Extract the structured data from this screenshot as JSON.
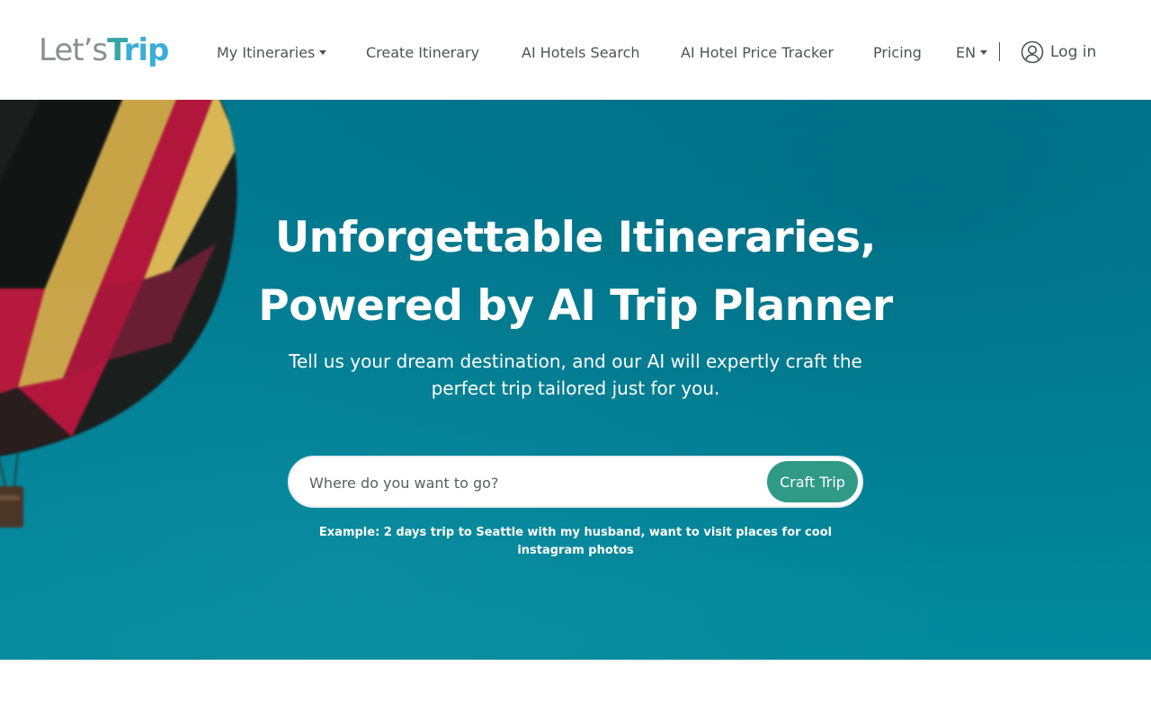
{
  "logo": {
    "part1": "Let’s",
    "part2_t": "T",
    "part2_rest": "rip"
  },
  "nav": {
    "my_itineraries": "My Itineraries",
    "create_itinerary": "Create Itinerary",
    "ai_hotels_search": "AI Hotels Search",
    "ai_hotel_price_tracker": "AI Hotel Price Tracker",
    "pricing": "Pricing",
    "language": "EN",
    "login": "Log in"
  },
  "icons": {
    "user": "user-circle-icon",
    "caret": "caret-down-icon"
  },
  "hero": {
    "title_line1": "Unforgettable Itineraries,",
    "title_line2": "Powered by AI Trip Planner",
    "subtitle": "Tell us your dream destination, and our AI will expertly craft the perfect trip tailored just for you.",
    "search_placeholder": "Where do you want to go?",
    "search_value": "",
    "button_label": "Craft Trip",
    "example": "Example: 2 days trip to Seattle with my husband, want to visit places for cool instagram photos"
  },
  "colors": {
    "brand_teal": "#2f9a86",
    "hero_bg": "#017f95",
    "logo_blue": "#3aaed8",
    "logo_grey": "#8a8f94",
    "nav_text": "#4f5256"
  }
}
